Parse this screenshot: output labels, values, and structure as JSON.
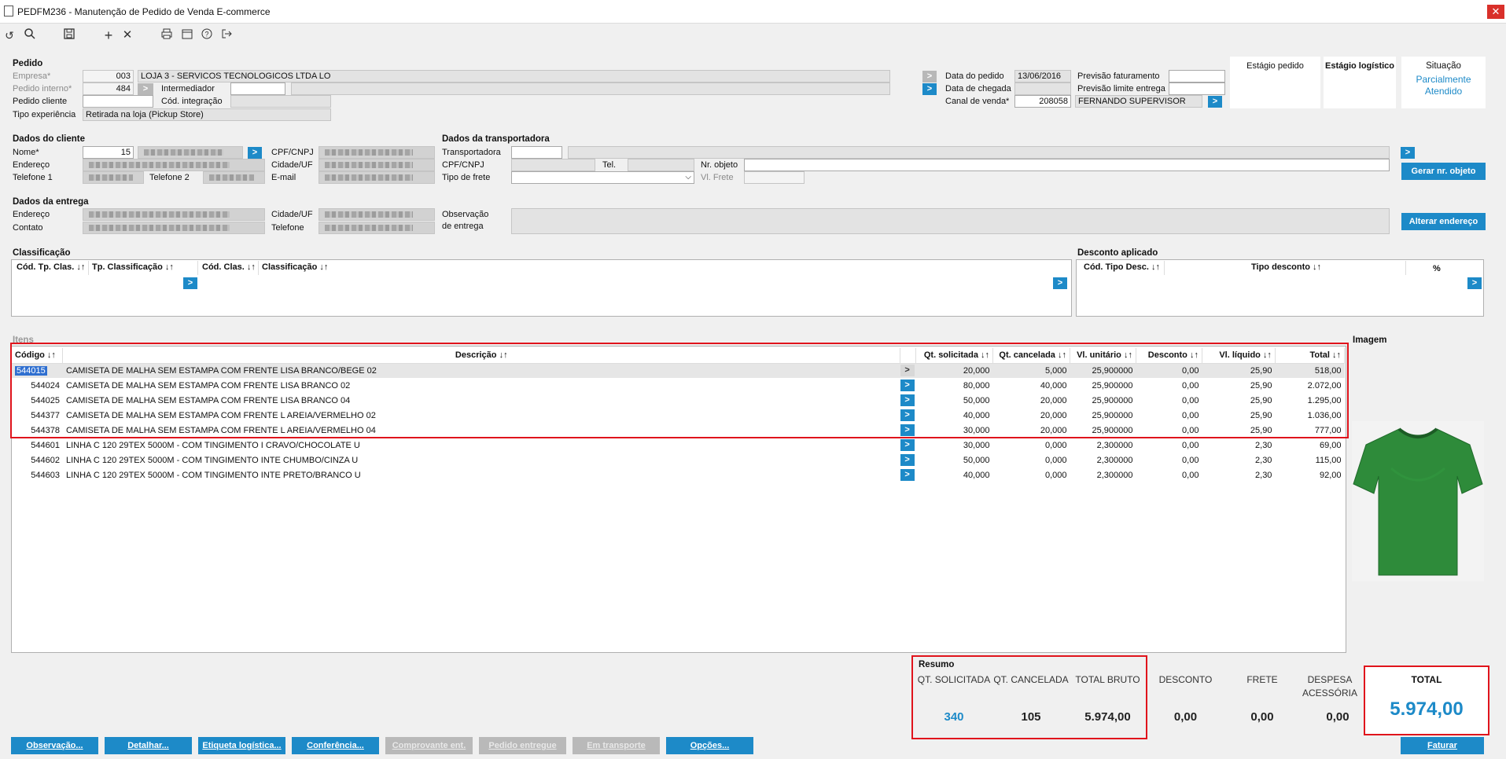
{
  "window": {
    "title": "PEDFM236 - Manutenção de Pedido de Venda E-commerce",
    "close": "✕"
  },
  "pedido": {
    "section": "Pedido",
    "empresa_label": "Empresa*",
    "empresa": "003",
    "empresa_nome": "LOJA 3 - SERVICOS TECNOLOGICOS LTDA  LO",
    "pedido_interno_label": "Pedido interno*",
    "pedido_interno": "484",
    "intermediador_label": "Intermediador",
    "pedido_cliente_label": "Pedido cliente",
    "cod_integracao_label": "Cód. integração",
    "tipo_experiencia_label": "Tipo experiência",
    "tipo_experiencia": "Retirada na loja (Pickup Store)",
    "data_pedido_label": "Data do pedido",
    "data_pedido": "13/06/2016",
    "data_chegada_label": "Data de chegada",
    "canal_venda_label": "Canal de venda*",
    "canal_venda": "208058",
    "canal_nome": "FERNANDO SUPERVISOR",
    "previsao_fat_label": "Previsão faturamento",
    "previsao_limite_label": "Previsão limite entrega",
    "estagio_pedido_label": "Estágio pedido",
    "estagio_logistico_label": "Estágio logístico",
    "situacao_label": "Situação",
    "situacao": "Parcialmente Atendido"
  },
  "cliente": {
    "section": "Dados do cliente",
    "nome_label": "Nome*",
    "nome_code": "15",
    "endereco_label": "Endereço",
    "telefone1_label": "Telefone 1",
    "telefone2_label": "Telefone 2",
    "cpf_label": "CPF/CNPJ",
    "cidade_label": "Cidade/UF",
    "email_label": "E-mail"
  },
  "transportadora": {
    "section": "Dados da transportadora",
    "transportadora_label": "Transportadora",
    "cpf_label": "CPF/CNPJ",
    "tel_label": "Tel.",
    "nr_objeto_label": "Nr. objeto",
    "tipo_frete_label": "Tipo de frete",
    "vl_frete_label": "Vl. Frete",
    "gerar_button": "Gerar nr. objeto"
  },
  "entrega": {
    "section": "Dados da entrega",
    "endereco_label": "Endereço",
    "contato_label": "Contato",
    "cidade_label": "Cidade/UF",
    "telefone_label": "Telefone",
    "obs_label1": "Observação",
    "obs_label2": "de entrega",
    "alterar_button": "Alterar endereço"
  },
  "classificacao": {
    "section": "Classificação",
    "cols": [
      "Cód. Tp. Clas. ↓↑",
      "Tp. Classificação ↓↑",
      "Cód. Clas. ↓↑",
      "Classificação ↓↑"
    ]
  },
  "desconto": {
    "section": "Desconto aplicado",
    "cols": [
      "Cód. Tipo Desc. ↓↑",
      "Tipo desconto ↓↑",
      "%"
    ]
  },
  "items": {
    "section": "Itens",
    "cols": [
      "Código ↓↑",
      "Descrição ↓↑",
      "",
      "Qt. solicitada ↓↑",
      "Qt. cancelada ↓↑",
      "Vl. unitário ↓↑",
      "Desconto ↓↑",
      "Vl. líquido ↓↑",
      "Total ↓↑"
    ],
    "rows": [
      {
        "codigo": "544015",
        "descricao": "CAMISETA DE MALHA SEM ESTAMPA COM FRENTE LISA BRANCO/BEGE 02",
        "qt_sol": "20,000",
        "qt_canc": "5,000",
        "vl_unit": "25,900000",
        "desconto": "0,00",
        "vl_liq": "25,90",
        "total": "518,00"
      },
      {
        "codigo": "544024",
        "descricao": "CAMISETA DE MALHA SEM ESTAMPA COM FRENTE LISA BRANCO 02",
        "qt_sol": "80,000",
        "qt_canc": "40,000",
        "vl_unit": "25,900000",
        "desconto": "0,00",
        "vl_liq": "25,90",
        "total": "2.072,00"
      },
      {
        "codigo": "544025",
        "descricao": "CAMISETA DE MALHA SEM ESTAMPA COM FRENTE LISA BRANCO 04",
        "qt_sol": "50,000",
        "qt_canc": "20,000",
        "vl_unit": "25,900000",
        "desconto": "0,00",
        "vl_liq": "25,90",
        "total": "1.295,00"
      },
      {
        "codigo": "544377",
        "descricao": "CAMISETA DE MALHA SEM ESTAMPA COM FRENTE L AREIA/VERMELHO 02",
        "qt_sol": "40,000",
        "qt_canc": "20,000",
        "vl_unit": "25,900000",
        "desconto": "0,00",
        "vl_liq": "25,90",
        "total": "1.036,00"
      },
      {
        "codigo": "544378",
        "descricao": "CAMISETA DE MALHA SEM ESTAMPA COM FRENTE L AREIA/VERMELHO 04",
        "qt_sol": "30,000",
        "qt_canc": "20,000",
        "vl_unit": "25,900000",
        "desconto": "0,00",
        "vl_liq": "25,90",
        "total": "777,00"
      },
      {
        "codigo": "544601",
        "descricao": "LINHA C 120 29TEX 5000M - COM TINGIMENTO I CRAVO/CHOCOLATE U",
        "qt_sol": "30,000",
        "qt_canc": "0,000",
        "vl_unit": "2,300000",
        "desconto": "0,00",
        "vl_liq": "2,30",
        "total": "69,00"
      },
      {
        "codigo": "544602",
        "descricao": "LINHA C 120 29TEX 5000M - COM TINGIMENTO INTE CHUMBO/CINZA U",
        "qt_sol": "50,000",
        "qt_canc": "0,000",
        "vl_unit": "2,300000",
        "desconto": "0,00",
        "vl_liq": "2,30",
        "total": "115,00"
      },
      {
        "codigo": "544603",
        "descricao": "LINHA C 120 29TEX 5000M - COM TINGIMENTO INTE PRETO/BRANCO U",
        "qt_sol": "40,000",
        "qt_canc": "0,000",
        "vl_unit": "2,300000",
        "desconto": "0,00",
        "vl_liq": "2,30",
        "total": "92,00"
      }
    ]
  },
  "imagem_label": "Imagem",
  "resumo": {
    "section": "Resumo",
    "qt_sol_label": "QT. SOLICITADA",
    "qt_sol": "340",
    "qt_canc_label": "QT. CANCELADA",
    "qt_canc": "105",
    "total_bruto_label": "TOTAL BRUTO",
    "total_bruto": "5.974,00",
    "desconto_label": "DESCONTO",
    "desconto": "0,00",
    "frete_label": "FRETE",
    "frete": "0,00",
    "despesa_label1": "DESPESA",
    "despesa_label2": "ACESSÓRIA",
    "despesa": "0,00",
    "total_label": "TOTAL",
    "total": "5.974,00"
  },
  "buttons": {
    "observacao": "Observação...",
    "detalhar": "Detalhar...",
    "etiqueta": "Etiqueta logística...",
    "conferencia": "Conferência...",
    "comprovante": "Comprovante ent.",
    "pedido_entregue": "Pedido entregue",
    "em_transporte": "Em transporte",
    "opcoes": "Opções...",
    "faturar": "Faturar"
  },
  "colors": {
    "accent": "#1d8ac8",
    "highlight": "#e0141c",
    "situacao": "#1d8ac8"
  }
}
